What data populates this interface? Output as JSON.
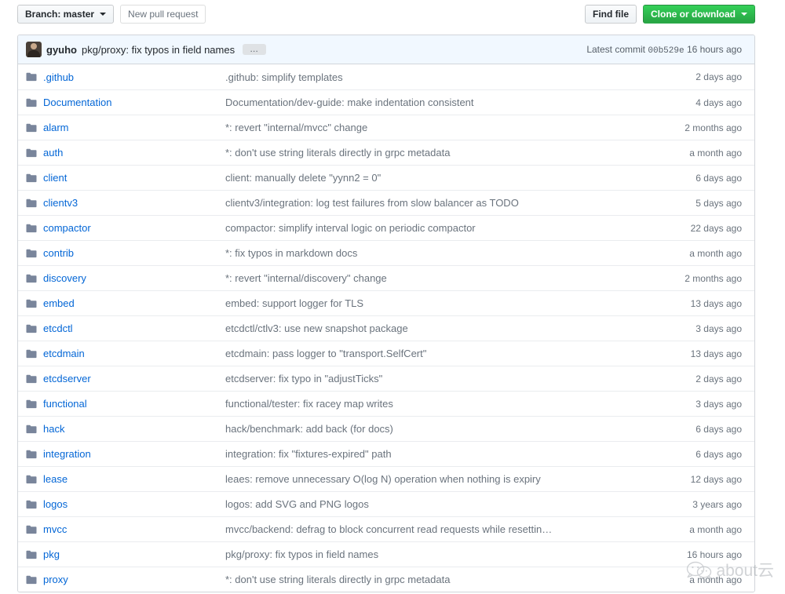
{
  "toolbar": {
    "branch_button": "Branch: master",
    "new_pull_request": "New pull request",
    "find_file": "Find file",
    "clone_or_download": "Clone or download"
  },
  "commit_bar": {
    "author": "gyuho",
    "message": "pkg/proxy: fix typos in field names",
    "expand_label": "…",
    "latest_commit_label": "Latest commit",
    "sha": "00b529e",
    "age": "16 hours ago"
  },
  "colors": {
    "link": "#0366d6",
    "green_button": "#2cbe4e",
    "commit_bar_bg": "#f1f8ff",
    "border": "#d1d5da",
    "row_border": "#eaecef",
    "muted_text": "#6a737d",
    "folder_icon": "#79859b"
  },
  "files": [
    {
      "type": "folder",
      "name": ".github",
      "message": ".github: simplify templates",
      "age": "2 days ago"
    },
    {
      "type": "folder",
      "name": "Documentation",
      "message": "Documentation/dev-guide: make indentation consistent",
      "age": "4 days ago"
    },
    {
      "type": "folder",
      "name": "alarm",
      "message": "*: revert \"internal/mvcc\" change",
      "age": "2 months ago"
    },
    {
      "type": "folder",
      "name": "auth",
      "message": "*: don't use string literals directly in grpc metadata",
      "age": "a month ago"
    },
    {
      "type": "folder",
      "name": "client",
      "message": "client: manually delete \"yynn2 = 0\"",
      "age": "6 days ago"
    },
    {
      "type": "folder",
      "name": "clientv3",
      "message": "clientv3/integration: log test failures from slow balancer as TODO",
      "age": "5 days ago"
    },
    {
      "type": "folder",
      "name": "compactor",
      "message": "compactor: simplify interval logic on periodic compactor",
      "age": "22 days ago"
    },
    {
      "type": "folder",
      "name": "contrib",
      "message": "*: fix typos in markdown docs",
      "age": "a month ago"
    },
    {
      "type": "folder",
      "name": "discovery",
      "message": "*: revert \"internal/discovery\" change",
      "age": "2 months ago"
    },
    {
      "type": "folder",
      "name": "embed",
      "message": "embed: support logger for TLS",
      "age": "13 days ago"
    },
    {
      "type": "folder",
      "name": "etcdctl",
      "message": "etcdctl/ctlv3: use new snapshot package",
      "age": "3 days ago"
    },
    {
      "type": "folder",
      "name": "etcdmain",
      "message": "etcdmain: pass logger to \"transport.SelfCert\"",
      "age": "13 days ago"
    },
    {
      "type": "folder",
      "name": "etcdserver",
      "message": "etcdserver: fix typo in \"adjustTicks\"",
      "age": "2 days ago"
    },
    {
      "type": "folder",
      "name": "functional",
      "message": "functional/tester: fix racey map writes",
      "age": "3 days ago"
    },
    {
      "type": "folder",
      "name": "hack",
      "message": "hack/benchmark: add back (for docs)",
      "age": "6 days ago"
    },
    {
      "type": "folder",
      "name": "integration",
      "message": "integration: fix \"fixtures-expired\" path",
      "age": "6 days ago"
    },
    {
      "type": "folder",
      "name": "lease",
      "message": "leaes: remove unnecessary O(log N) operation when nothing is expiry",
      "age": "12 days ago"
    },
    {
      "type": "folder",
      "name": "logos",
      "message": "logos: add SVG and PNG logos",
      "age": "3 years ago"
    },
    {
      "type": "folder",
      "name": "mvcc",
      "message": "mvcc/backend: defrag to block concurrent read requests while resettin…",
      "age": "a month ago"
    },
    {
      "type": "folder",
      "name": "pkg",
      "message": "pkg/proxy: fix typos in field names",
      "age": "16 hours ago"
    },
    {
      "type": "folder",
      "name": "proxy",
      "message": "*: don't use string literals directly in grpc metadata",
      "age": "a month ago"
    }
  ],
  "watermark": {
    "text": "about云"
  }
}
